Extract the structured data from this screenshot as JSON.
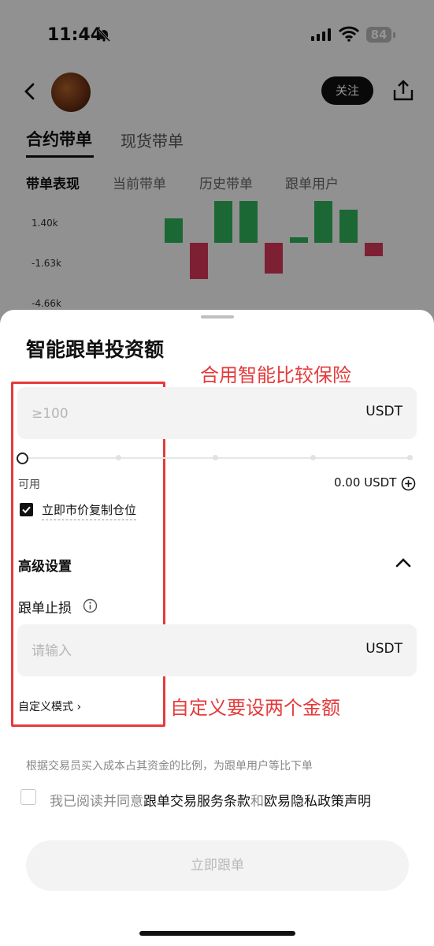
{
  "status_bar": {
    "time": "11:44",
    "battery": "84"
  },
  "header": {
    "follow_label": "关注"
  },
  "main_tabs": [
    {
      "label": "合约带单"
    },
    {
      "label": "现货带单"
    }
  ],
  "sub_tabs": [
    {
      "label": "带单表现"
    },
    {
      "label": "当前带单"
    },
    {
      "label": "历史带单"
    },
    {
      "label": "跟单用户"
    }
  ],
  "chart_data": {
    "type": "bar",
    "y_tick_labels": [
      "1.40k",
      "-1.63k",
      "-4.66k"
    ],
    "values": [
      1.1,
      -1.63,
      1.9,
      1.9,
      -1.4,
      0.25,
      1.9,
      1.5,
      -0.6
    ],
    "colors": {
      "positive": "#2fb45c",
      "negative": "#d8385a"
    }
  },
  "sheet": {
    "title": "智能跟单投资额",
    "amount": {
      "placeholder": "≥100",
      "unit": "USDT"
    },
    "available": {
      "label": "可用",
      "value": "0.00 USDT"
    },
    "copy_position": {
      "label": "立即市价复制仓位",
      "checked": true
    },
    "advanced": {
      "title": "高级设置"
    },
    "stop_loss": {
      "label": "跟单止损",
      "placeholder": "请输入",
      "unit": "USDT"
    },
    "custom_mode": {
      "label": "自定义模式 ›"
    },
    "disclaimer": "根据交易员买入成本占其资金的比例，为跟单用户等比下单",
    "agreement": {
      "prefix": "我已阅读并同意",
      "link1": "跟单交易服务条款",
      "middle": "和",
      "link2": "欧易隐私政策声明",
      "checked": false
    },
    "submit_label": "立即跟单"
  },
  "annotations": {
    "note1": "合用智能比较保险",
    "note2": "自定义要设两个金额"
  },
  "accent_colors": {
    "annotation_red": "#e53b3b",
    "primary_dark": "#111111"
  }
}
